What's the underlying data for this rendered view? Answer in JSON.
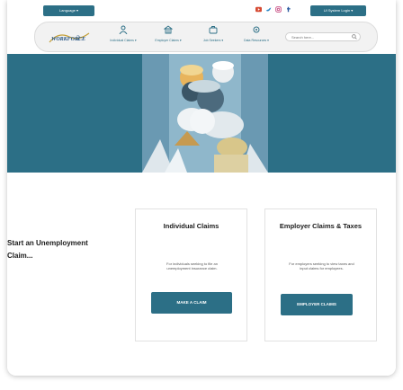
{
  "topbar": {
    "language_label": "Language ▾",
    "login_label": "UI System Login ▾",
    "social_icons": [
      "youtube-icon",
      "twitter-icon",
      "instagram-icon",
      "facebook-icon"
    ]
  },
  "navbar": {
    "logo_text": "WORKFORCE",
    "items": [
      {
        "label": "Individual Claims ▾",
        "icon": "person-icon"
      },
      {
        "label": "Employer Claims ▾",
        "icon": "building-icon"
      },
      {
        "label": "Job Seekers ▾",
        "icon": "briefcase-icon"
      },
      {
        "label": "Data Resources ▾",
        "icon": "gear-icon"
      }
    ],
    "search_placeholder": "Search here..."
  },
  "welcome": {
    "intro": "Start an Unemployment Claim..."
  },
  "cards": [
    {
      "title": "Individual Claims",
      "description": "For individuals seeking to file an unemployment insurance claim.",
      "button": "MAKE A CLAIM"
    },
    {
      "title": "Employer Claims & Taxes",
      "description": "For employers seeking to view taxes and input claims for employees.",
      "button": "EMPLOYER CLAIMS"
    }
  ],
  "colors": {
    "brand": "#2c6f86",
    "hero_bg": "#2c6f86"
  }
}
